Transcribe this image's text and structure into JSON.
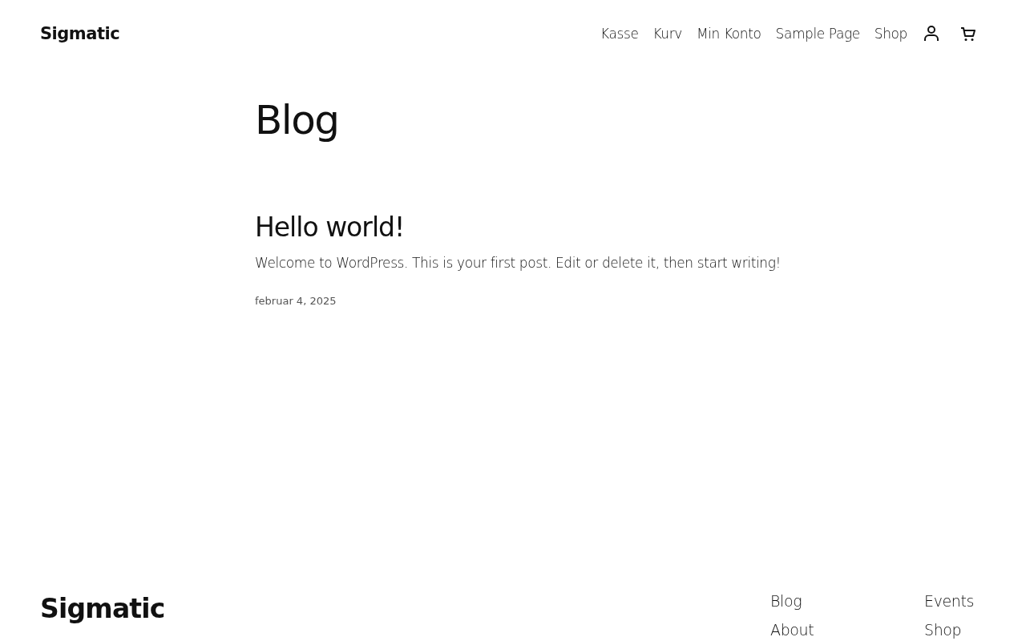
{
  "header": {
    "site_title": "Sigmatic",
    "nav": [
      "Kasse",
      "Kurv",
      "Min Konto",
      "Sample Page",
      "Shop"
    ]
  },
  "main": {
    "page_title": "Blog",
    "posts": [
      {
        "title": "Hello world!",
        "excerpt": "Welcome to WordPress. This is your first post. Edit or delete it, then start writing!",
        "date": "februar 4, 2025"
      }
    ]
  },
  "footer": {
    "site_title": "Sigmatic",
    "columns": [
      [
        "Blog",
        "About"
      ],
      [
        "Events",
        "Shop"
      ]
    ]
  }
}
